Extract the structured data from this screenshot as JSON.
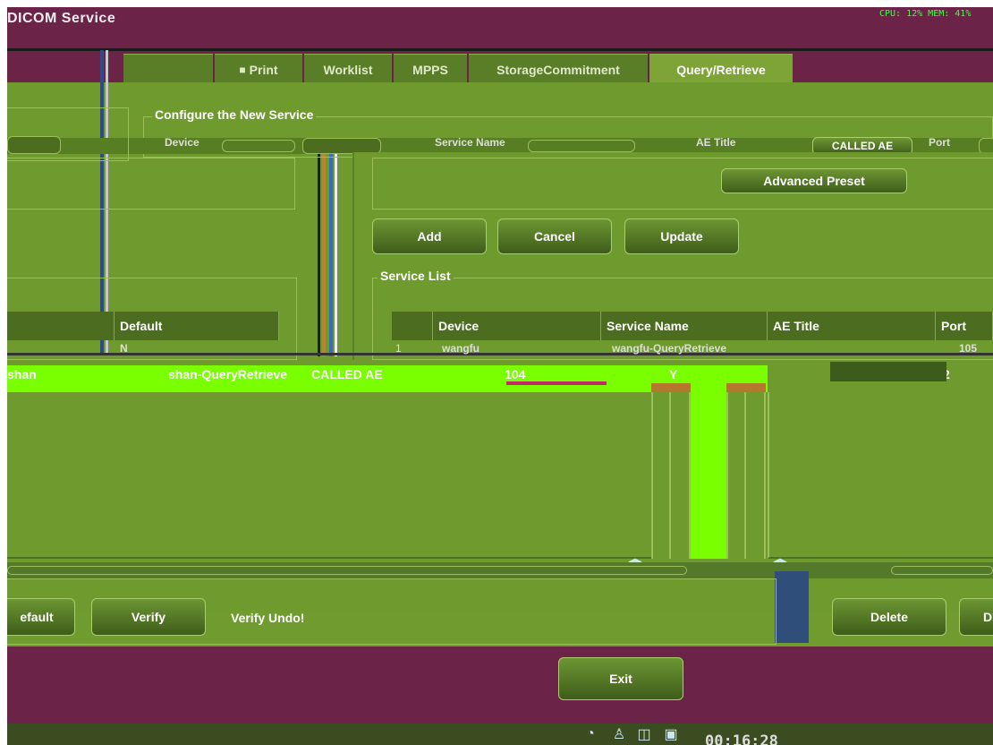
{
  "window": {
    "title": "DICOM Service",
    "system_monitor": "CPU: 12%  MEM: 41%"
  },
  "tabs": [
    {
      "label": "Print"
    },
    {
      "label": "Worklist"
    },
    {
      "label": "MPPS"
    },
    {
      "label": "StorageCommitment"
    },
    {
      "label": "Query/Retrieve",
      "active": true
    }
  ],
  "configure": {
    "group_title": "Configure the New Service",
    "device_label": "Device",
    "service_name_label": "Service Name",
    "ae_title_label": "AE Title",
    "ae_title_value": "CALLED AE",
    "port_label": "Port",
    "advanced_preset_label": "Advanced Preset",
    "add_label": "Add",
    "cancel_label": "Cancel",
    "update_label": "Update"
  },
  "left_list": {
    "columns": [
      "",
      "Default"
    ],
    "row_default": "N"
  },
  "service_list": {
    "group_title": "Service List",
    "columns": [
      "Device",
      "Service Name",
      "AE Title",
      "Port"
    ],
    "rows": [
      {
        "index": "1",
        "device": "wangfu",
        "service_name": "wangfu-QueryRetrieve",
        "ae_title": "",
        "port": "105"
      },
      {
        "index": "2",
        "device": "shan",
        "service_name": "shan-QueryRetrieve",
        "ae_title": "CALLED AE",
        "port": "104",
        "default": "Y"
      }
    ]
  },
  "bottom_buttons": {
    "default_label": "efault",
    "verify_label": "Verify",
    "verify_status": "Verify Undo!",
    "delete_label": "Delete",
    "partial_right_label": "D",
    "exit_label": "Exit"
  },
  "taskbar": {
    "clock": "00:16:28"
  },
  "colors": {
    "panel_green": "#6e9a2e",
    "tab_active": "#7ea337",
    "bar_magenta": "#6c2348",
    "highlight_green": "#7aff00"
  }
}
